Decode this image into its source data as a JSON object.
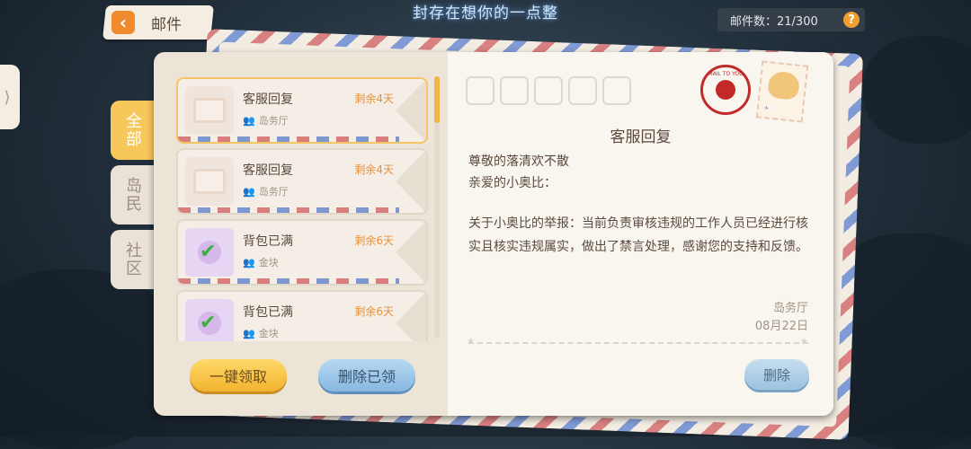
{
  "header": {
    "top_title": "封存在想你的一点整",
    "back_label": "邮件",
    "mail_count_label": "邮件数：21/300",
    "help": "?"
  },
  "tabs": [
    {
      "label": "全部",
      "active": true
    },
    {
      "label": "岛民",
      "active": false
    },
    {
      "label": "社区",
      "active": false
    }
  ],
  "mail_list": [
    {
      "title": "客服回复",
      "sender": "岛务厅",
      "remaining": "剩余4天",
      "icon": "letter-paper-icon",
      "selected": true
    },
    {
      "title": "客服回复",
      "sender": "岛务厅",
      "remaining": "剩余4天",
      "icon": "letter-paper-icon",
      "selected": false
    },
    {
      "title": "背包已满",
      "sender": "金块",
      "remaining": "剩余6天",
      "icon": "full-bag-icon",
      "selected": false
    },
    {
      "title": "背包已满",
      "sender": "金块",
      "remaining": "剩余6天",
      "icon": "full-bag-icon",
      "selected": false
    }
  ],
  "actions": {
    "claim_all": "一键领取",
    "delete_read": "删除已领",
    "delete": "删除"
  },
  "letter": {
    "title": "客服回复",
    "greeting1": "尊敬的落清欢不散",
    "greeting2": "亲爱的小奥比：",
    "body": "关于小奥比的举报：当前负责审核违规的工作人员已经进行核实且核实违规属实，做出了禁言处理，感谢您的支持和反馈。",
    "from": "岛务厅",
    "date": "08月22日",
    "postmark_text": "MAIL TO YOU"
  },
  "colors": {
    "accent_orange": "#f08a2d",
    "tab_active": "#f6c75a",
    "remaining_text": "#e6913a",
    "postmark_red": "#c22a2a"
  }
}
